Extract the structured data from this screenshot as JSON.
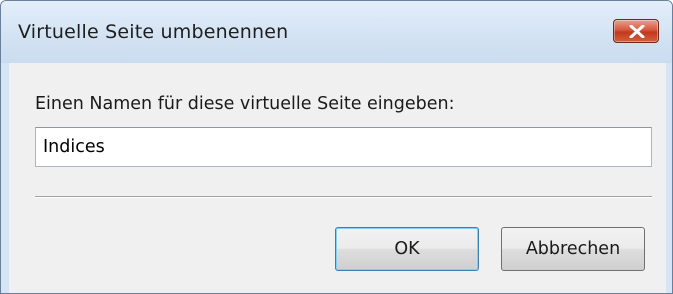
{
  "dialog": {
    "title": "Virtuelle Seite umbenennen",
    "close_icon": "close-icon",
    "prompt_label": "Einen Namen für diese virtuelle Seite eingeben:",
    "name_input": {
      "value": "Indices",
      "placeholder": ""
    },
    "buttons": {
      "ok_label": "OK",
      "cancel_label": "Abbrechen"
    }
  },
  "colors": {
    "close_button": "#c2391d",
    "title_bar": "#d6e5f5",
    "content_background": "#f0f0f0",
    "default_button_border": "#3c7fb1"
  }
}
